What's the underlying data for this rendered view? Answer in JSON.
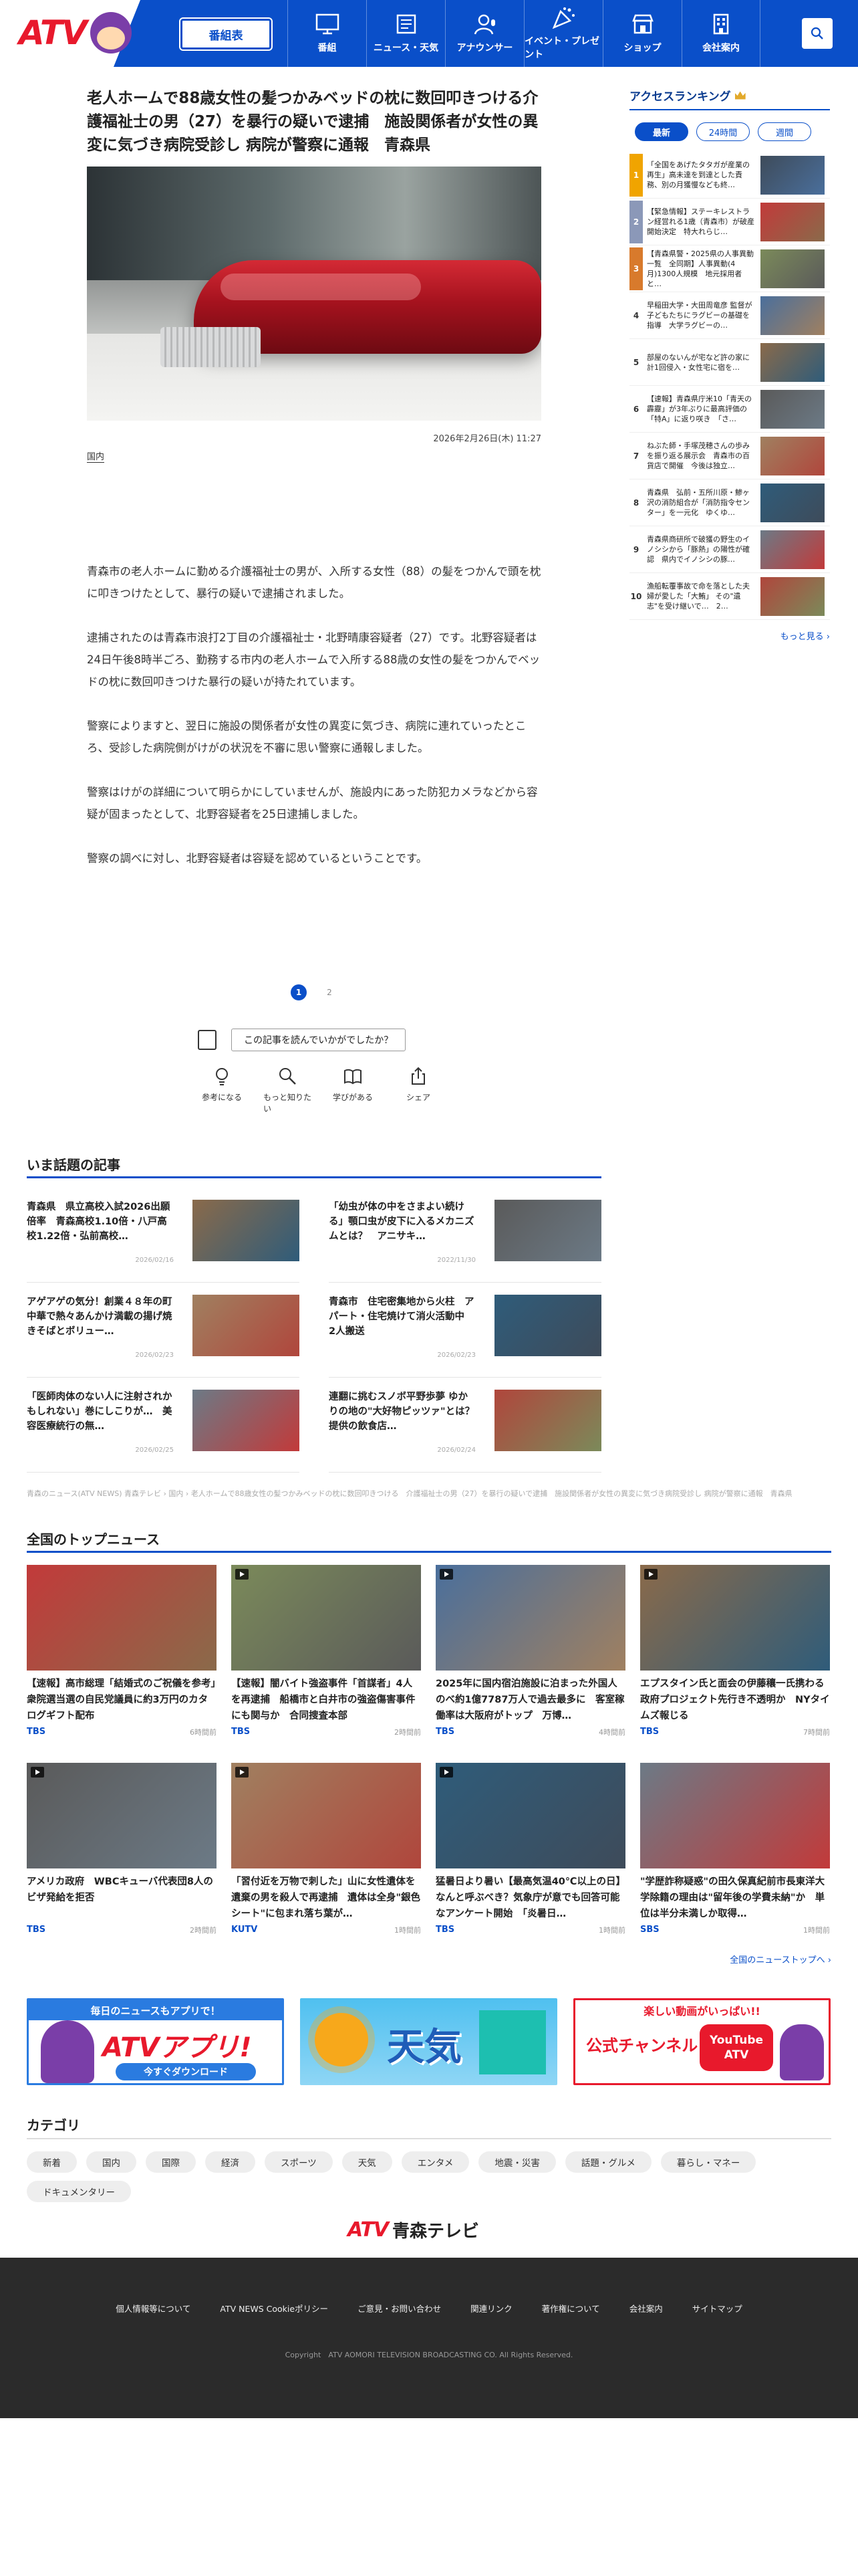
{
  "header": {
    "logo": "ATV",
    "program_button": "番組表",
    "nav": [
      {
        "label": "番組",
        "icon": "tv-icon"
      },
      {
        "label": "ニュース・天気",
        "icon": "news-icon"
      },
      {
        "label": "アナウンサー",
        "icon": "announcer-icon"
      },
      {
        "label": "イベント・プレゼント",
        "icon": "event-icon"
      },
      {
        "label": "ショップ",
        "icon": "shop-icon"
      },
      {
        "label": "会社案内",
        "icon": "building-icon"
      }
    ],
    "search_icon": "search-icon",
    "brand_color": "#0a4fc9",
    "logo_color": "#e8192c"
  },
  "article": {
    "title": "老人ホームで88歳女性の髪つかみベッドの枕に数回叩きつける介護福祉士の男（27）を暴行の疑いで逮捕　施設関係者が女性の異変に気づき病院受診し 病院が警察に通報　青森県",
    "date": "2026年2月26日(木) 11:27",
    "category": "国内",
    "paragraphs": [
      "青森市の老人ホームに勤める介護福祉士の男が、入所する女性（88）の髪をつかんで頭を枕に叩きつけたとして、暴行の疑いで逮捕されました。",
      "逮捕されたのは青森市浪打2丁目の介護福祉士・北野晴康容疑者（27）です。北野容疑者は24日午後8時半ごろ、勤務する市内の老人ホームで入所する88歳の女性の髪をつかんでベッドの枕に数回叩きつけた暴行の疑いが持たれています。",
      "警察によりますと、翌日に施設の関係者が女性の異変に気づき、病院に連れていったところ、受診した病院側がけがの状況を不審に思い警察に通報しました。",
      "警察はけがの詳細について明らかにしていませんが、施設内にあった防犯カメラなどから容疑が固まったとして、北野容疑者を25日逮捕しました。",
      "警察の調べに対し、北野容疑者は容疑を認めているということです。"
    ],
    "pages": [
      "1",
      "2"
    ],
    "current_page": "1",
    "feedback_question": "この記事を読んでいかがでしたか？",
    "reactions": [
      {
        "label": "参考になる",
        "icon": "lightbulb-icon"
      },
      {
        "label": "もっと知りたい",
        "icon": "magnifier-icon"
      },
      {
        "label": "学びがある",
        "icon": "book-icon"
      },
      {
        "label": "シェア",
        "icon": "share-icon"
      }
    ]
  },
  "ranking": {
    "title": "アクセスランキング",
    "tabs": [
      "最新",
      "24時間",
      "週間"
    ],
    "active_tab": "最新",
    "items": [
      {
        "rank": "1",
        "color": "#f0a400",
        "text": "「全国をあげたタタガが産業の再生」高未達を到達とした責務、別の月獲慢なども終…"
      },
      {
        "rank": "2",
        "color": "#8b98b8",
        "text": "【緊急情報】ステーキレストラン経営れる1歳（青森市）が破産開始決定　特大れらじ…"
      },
      {
        "rank": "3",
        "color": "#d87a2c",
        "text": "【青森県警・2025県の人事異動一覧　全同期】人事異動(4月)1300人規模　地元採用者と…"
      },
      {
        "rank": "4",
        "color": "#ffffff",
        "text": "早稲田大学・大田周竜彦 監督が子どもたちにラグビーの基礎を指導　大学ラグビーの…"
      },
      {
        "rank": "5",
        "color": "#ffffff",
        "text": "部屋のないんが宅など許の家に計1回侵入・女性宅に宿を…"
      },
      {
        "rank": "6",
        "color": "#ffffff",
        "text": "【速報】青森県庁米10「青天の霹靂」が3年ぶりに最高評価の「特A」に返り咲き　「さ…"
      },
      {
        "rank": "7",
        "color": "#ffffff",
        "text": "ねぶた師・手塚茂穂さんの歩みを振り返る展示会　青森市の百貨店で開催　今後は独立…"
      },
      {
        "rank": "8",
        "color": "#ffffff",
        "text": "青森県　弘前・五所川原・鯵ヶ沢の消防組合が「消防指令センター」を一元化　ゆくゆ…"
      },
      {
        "rank": "9",
        "color": "#ffffff",
        "text": "青森県商研所で破獲の野生のイノシシから「豚熱」の陽性が確認　県内でイノシシの豚…"
      },
      {
        "rank": "10",
        "color": "#ffffff",
        "text": "漁船転覆事故で命を落とした夫婦が愛した「大鮪」 その\"遺志\"を受け継いで…　2…"
      }
    ],
    "more": "もっと見る"
  },
  "trending": {
    "title": "いま話題の記事",
    "items": [
      {
        "title": "青森県　県立高校入試2026出願倍率　青森高校1.10倍・八戸高校1.22倍・弘前高校…",
        "date": "2026/02/16"
      },
      {
        "title": "「幼虫が体の中をさまよい続ける」顎口虫が皮下に入るメカニズムとは？　アニサキ…",
        "date": "2022/11/30"
      },
      {
        "title": "アゲアゲの気分！創業４８年の町中華で熱々あんかけ満載の揚げ焼きそばとボリュー…",
        "date": "2026/02/23"
      },
      {
        "title": "青森市　住宅密集地から火柱　アパート・住宅焼けて消火活動中　2人搬送",
        "date": "2026/02/23"
      },
      {
        "title": "「医師肉体のない人に注射されかもしれない」巻にしこりが…　美容医療統行の無…",
        "date": "2026/02/25"
      },
      {
        "title": "連翻に挑むスノボ平野歩夢 ゆかりの地の\"大好物ピッツァ\"とは？　提供の飲食店…",
        "date": "2026/02/24"
      }
    ]
  },
  "breadcrumb": [
    "青森のニュース(ATV NEWS) 青森テレビ",
    "国内",
    "老人ホームで88歳女性の髪つかみベッドの枕に数回叩きつける　介護福祉士の男（27）を暴行の疑いで逮捕　施設関係者が女性の異変に気づき病院受診し 病院が警察に通報　青森県"
  ],
  "national": {
    "title": "全国のトップニュース",
    "items": [
      {
        "title": "【速報】高市総理「結婚式のご祝儀を参考」　衆院選当選の自民党議員に約3万円のカタログギフト配布",
        "source": "TBS",
        "ago": "6時間前",
        "video": false
      },
      {
        "title": "【速報】闇バイト強盗事件「首謀者」4人を再逮捕　船橋市と白井市の強盗傷害事件にも関与か　合同捜査本部",
        "source": "TBS",
        "ago": "2時間前",
        "video": true
      },
      {
        "title": "2025年に国内宿泊施設に泊まった外国人のべ約1億7787万人で過去最多に　客室稼働率は大阪府がトップ　万博…",
        "source": "TBS",
        "ago": "4時間前",
        "video": true
      },
      {
        "title": "エプスタイン氏と面会の伊藤穰一氏携わる政府プロジェクト先行き不透明か　NYタイムズ報じる",
        "source": "TBS",
        "ago": "7時間前",
        "video": true
      },
      {
        "title": "アメリカ政府　WBCキューバ代表団8人のビザ発給を拒否",
        "source": "TBS",
        "ago": "2時間前",
        "video": true
      },
      {
        "title": "「習付近を万物で刺した」山に女性遺体を遺棄の男を殺人で再逮捕　遺体は全身\"銀色シート\"に包まれ落ち葉が…",
        "source": "KUTV",
        "ago": "1時間前",
        "video": true
      },
      {
        "title": "猛暑日より暑い【最高気温40℃以上の日】なんと呼ぶべき？気象庁が意でも回答可能なアンケート開始　「炎暑日…",
        "source": "TBS",
        "ago": "1時間前",
        "video": true
      },
      {
        "title": "\"学歴詐称疑惑\"の田久保真紀前市長東洋大学除籍の理由は\"留年後の学費未納\"か　単位は半分未満しか取得…",
        "source": "SBS",
        "ago": "1時間前",
        "video": false
      }
    ],
    "more": "全国のニューストップへ"
  },
  "banners": [
    {
      "top": "毎日のニュースもアプリで！",
      "main": "ATVアプリ!",
      "sub": "今すぐダウンロード"
    },
    {
      "top": "",
      "main": "天気",
      "sub": ""
    },
    {
      "top": "楽しい動画がいっぱい!!",
      "main": "公式チャンネル",
      "sub": "YouTube ATV"
    }
  ],
  "categories": {
    "title": "カテゴリ",
    "items": [
      "新着",
      "国内",
      "国際",
      "経済",
      "スポーツ",
      "天気",
      "エンタメ",
      "地震・災害",
      "話題・グルメ",
      "暮らし・マネー",
      "ドキュメンタリー"
    ]
  },
  "footer": {
    "logo_a": "ATV",
    "logo_b": "青森テレビ",
    "links": [
      "個人情報等について",
      "ATV NEWS Cookieポリシー",
      "ご意見・お問い合わせ",
      "関連リンク",
      "著作権について",
      "会社案内",
      "サイトマップ"
    ],
    "copyright": "Copyright　ATV AOMORI TELEVISION BROADCASTING CO. All Rights Reserved."
  }
}
